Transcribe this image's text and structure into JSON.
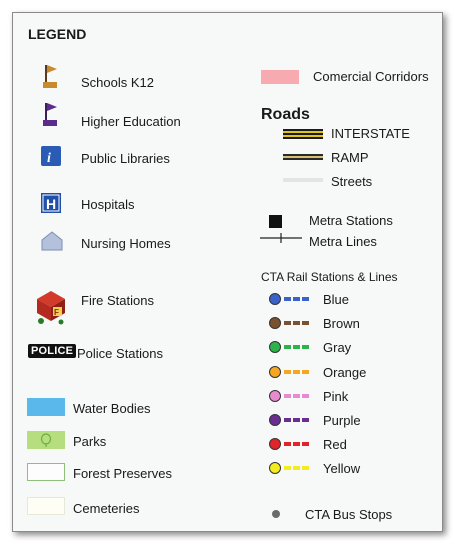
{
  "legend": {
    "title": "LEGEND",
    "points": {
      "schools": "Schools K12",
      "higher_ed": "Higher Education",
      "libraries": "Public Libraries",
      "hospitals": "Hospitals",
      "nursing": "Nursing Homes",
      "fire": "Fire Stations",
      "police": "Police Stations",
      "police_badge": "POLICE"
    },
    "areas": {
      "water": "Water Bodies",
      "parks": "Parks",
      "forest": "Forest Preserves",
      "cemeteries": "Cemeteries"
    },
    "commercial": "Comercial Corridors",
    "roads": {
      "title": "Roads",
      "interstate": "INTERSTATE",
      "ramp": "RAMP",
      "streets": "Streets"
    },
    "metra": {
      "stations": "Metra Stations",
      "lines": "Metra Lines"
    },
    "cta": {
      "title": "CTA Rail Stations & Lines",
      "lines": [
        {
          "name": "Blue",
          "color": "#3a63c9"
        },
        {
          "name": "Brown",
          "color": "#7a5230"
        },
        {
          "name": "Gray",
          "color": "#2db34a"
        },
        {
          "name": "Orange",
          "color": "#f6a623"
        },
        {
          "name": "Pink",
          "color": "#e88ad0"
        },
        {
          "name": "Purple",
          "color": "#6a2e91"
        },
        {
          "name": "Red",
          "color": "#e0242a"
        },
        {
          "name": "Yellow",
          "color": "#f4ec21"
        }
      ],
      "bus_stops": "CTA Bus Stops"
    },
    "colors": {
      "water": "#5bb8ea",
      "parks": "#b6de7e",
      "forest_border": "#8fc07a",
      "commercial": "#f7aab0",
      "interstate": "#e2c21d",
      "ramp": "#d7c071",
      "school_flag": "#c98a2e",
      "higher_flag": "#5b2d8a",
      "library": "#2a5bb5",
      "hospital": "#1f4fa8",
      "nursing": "#b3c1dd"
    }
  }
}
